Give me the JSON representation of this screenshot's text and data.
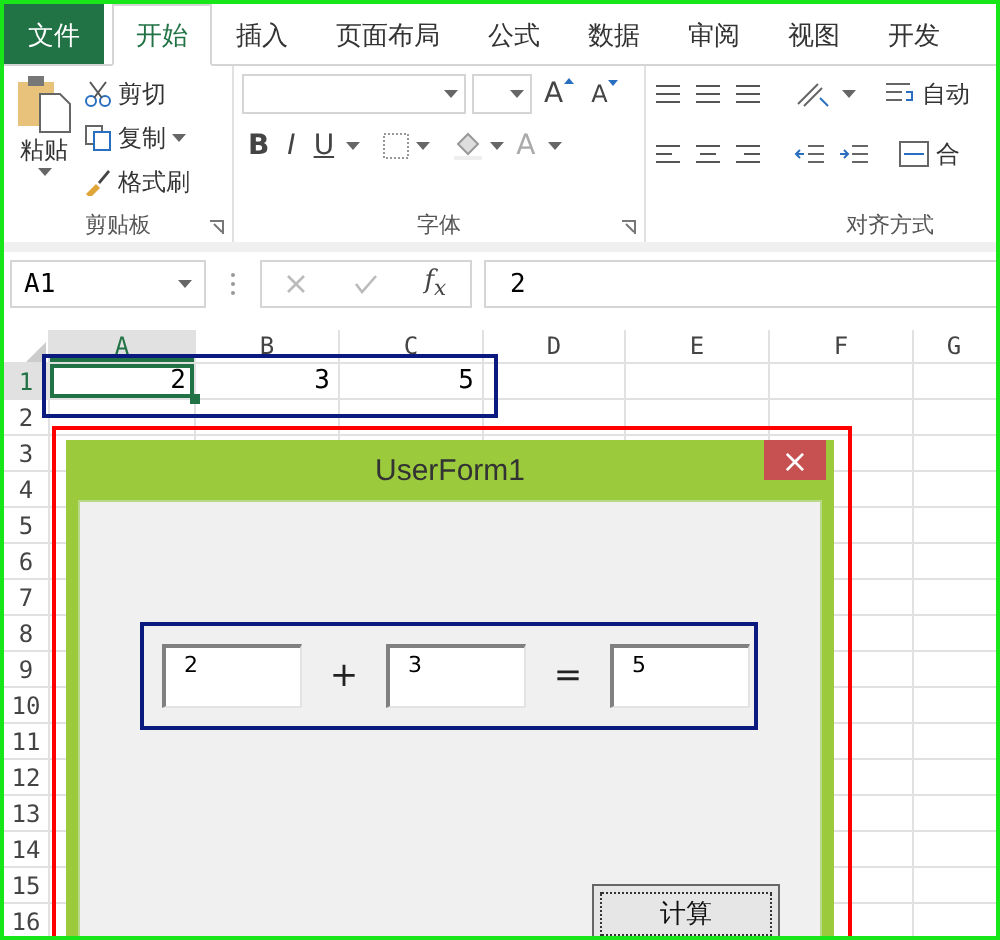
{
  "tabs": [
    {
      "label": "文件",
      "kind": "file",
      "selected": false
    },
    {
      "label": "开始",
      "kind": "tab",
      "selected": true
    },
    {
      "label": "插入",
      "kind": "tab",
      "selected": false
    },
    {
      "label": "页面布局",
      "kind": "tab",
      "selected": false
    },
    {
      "label": "公式",
      "kind": "tab",
      "selected": false
    },
    {
      "label": "数据",
      "kind": "tab",
      "selected": false
    },
    {
      "label": "审阅",
      "kind": "tab",
      "selected": false
    },
    {
      "label": "视图",
      "kind": "tab",
      "selected": false
    },
    {
      "label": "开发",
      "kind": "tab",
      "selected": false
    }
  ],
  "ribbon": {
    "clipboard": {
      "paste": "粘贴",
      "cut": "剪切",
      "copy": "复制",
      "format_painter": "格式刷",
      "label": "剪贴板"
    },
    "font": {
      "bold": "B",
      "italic": "I",
      "underline": "U",
      "grow": "A",
      "shrink": "A",
      "font_color": "A",
      "label": "字体"
    },
    "alignment": {
      "wrap": "自动",
      "merge": "合",
      "label": "对齐方式"
    }
  },
  "formula_bar": {
    "name_box": "A1",
    "fx": "f$_{x}$",
    "value": "2"
  },
  "sheet": {
    "columns": [
      {
        "label": "A",
        "selected": true
      },
      {
        "label": "B",
        "selected": false
      },
      {
        "label": "C",
        "selected": false
      },
      {
        "label": "D",
        "selected": false
      },
      {
        "label": "E",
        "selected": false
      },
      {
        "label": "F",
        "selected": false
      },
      {
        "label": "G",
        "selected": false
      }
    ],
    "rows": [
      {
        "label": "1",
        "selected": true,
        "cells": [
          {
            "value": "2",
            "selected": true
          },
          {
            "value": "3",
            "selected": false
          },
          {
            "value": "5",
            "selected": false
          }
        ]
      },
      {
        "label": "2",
        "selected": false
      },
      {
        "label": "3",
        "selected": false
      },
      {
        "label": "4",
        "selected": false
      },
      {
        "label": "5",
        "selected": false
      },
      {
        "label": "6",
        "selected": false
      },
      {
        "label": "7",
        "selected": false
      },
      {
        "label": "8",
        "selected": false
      },
      {
        "label": "9",
        "selected": false
      },
      {
        "label": "10",
        "selected": false
      },
      {
        "label": "11",
        "selected": false
      },
      {
        "label": "12",
        "selected": false
      },
      {
        "label": "13",
        "selected": false
      },
      {
        "label": "14",
        "selected": false
      },
      {
        "label": "15",
        "selected": false
      },
      {
        "label": "16",
        "selected": false
      }
    ]
  },
  "userform": {
    "title": "UserForm1",
    "close": "×",
    "first": "2",
    "operator": "+",
    "second": "3",
    "equals": "=",
    "result": "5",
    "button": "计算"
  },
  "annotations": [
    {
      "color": "#0b1a7e"
    },
    {
      "color": "#ff0000"
    }
  ]
}
